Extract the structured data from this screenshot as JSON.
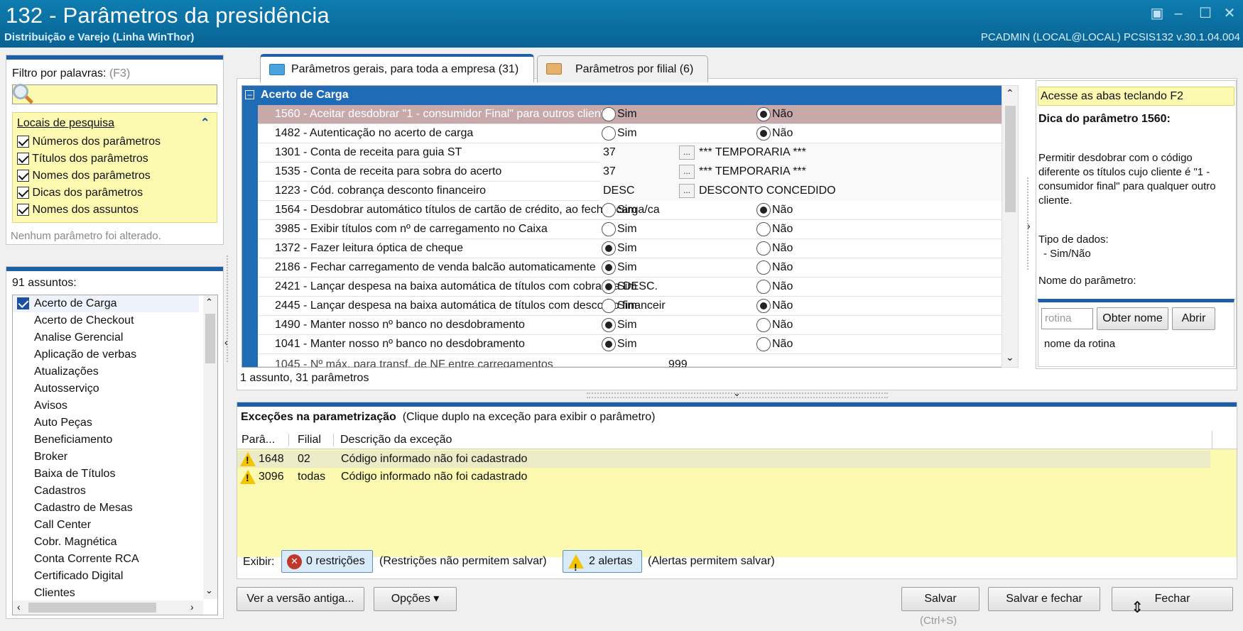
{
  "window": {
    "title": "132 - Parâmetros da presidência",
    "subtitle": "Distribuição e Varejo (Linha WinThor)",
    "user_info": "PCADMIN (LOCAL@LOCAL)   PCSIS132  v.30.1.04.004"
  },
  "filter": {
    "label": "Filtro por palavras:",
    "shortcut": "(F3)",
    "value": "",
    "locations_title": "Locais de pesquisa",
    "locations": [
      {
        "label": "Números dos parâmetros",
        "checked": true
      },
      {
        "label": "Títulos dos parâmetros",
        "checked": true
      },
      {
        "label": "Nomes dos parâmetros",
        "checked": true
      },
      {
        "label": "Dicas dos parâmetros",
        "checked": true
      },
      {
        "label": "Nomes dos assuntos",
        "checked": true
      }
    ],
    "status": "Nenhum parâmetro foi alterado."
  },
  "subjects": {
    "count_label": "91 assuntos:",
    "items": [
      {
        "label": "Acerto de Carga",
        "checked": true
      },
      {
        "label": "Acerto de Checkout"
      },
      {
        "label": "Analise Gerencial"
      },
      {
        "label": "Aplicação de verbas"
      },
      {
        "label": "Atualizações"
      },
      {
        "label": "Autosserviço"
      },
      {
        "label": "Avisos"
      },
      {
        "label": "Auto Peças"
      },
      {
        "label": "Beneficiamento"
      },
      {
        "label": "Broker"
      },
      {
        "label": "Baixa de Títulos"
      },
      {
        "label": "Cadastros"
      },
      {
        "label": "Cadastro de Mesas"
      },
      {
        "label": "Call Center"
      },
      {
        "label": "Cobr. Magnética"
      },
      {
        "label": "Conta Corrente RCA"
      },
      {
        "label": "Certificado Digital"
      },
      {
        "label": "Clientes"
      }
    ]
  },
  "tabs": [
    {
      "label": "Parâmetros gerais, para toda a empresa  (31)",
      "active": true
    },
    {
      "label": "Parâmetros por filial  (6)",
      "active": false
    }
  ],
  "grid": {
    "group_title": "Acerto de Carga",
    "rows": [
      {
        "name": "1560 - Aceitar desdobrar \"1 - consumidor Final\" para outros clientes",
        "type": "radio",
        "value": "Não",
        "selected": true
      },
      {
        "name": "1482 - Autenticação no acerto de carga",
        "type": "radio",
        "value": "Não"
      },
      {
        "name": "1301 - Conta de receita para guia ST",
        "type": "lookup",
        "code": "37",
        "desc": "*** TEMPORARIA ***"
      },
      {
        "name": "1535 - Conta de receita para sobra do acerto",
        "type": "lookup",
        "code": "37",
        "desc": "*** TEMPORARIA ***"
      },
      {
        "name": "1223 - Cód. cobrança desconto financeiro",
        "type": "lookup",
        "code": "DESC",
        "desc": "DESCONTO CONCEDIDO"
      },
      {
        "name": "1564 - Desdobrar automático títulos de cartão de crédito, ao fechar carga/ca",
        "type": "radio",
        "value": "Não"
      },
      {
        "name": "3985 - Exibir títulos com nº de carregamento no Caixa",
        "type": "radio",
        "value": ""
      },
      {
        "name": "1372 - Fazer leitura óptica de cheque",
        "type": "radio",
        "value": "Sim"
      },
      {
        "name": "2186 - Fechar carregamento de venda balcão automaticamente",
        "type": "radio",
        "value": "Sim"
      },
      {
        "name": "2421 - Lançar despesa na baixa automática de títulos com cobrança DESC.",
        "type": "radio",
        "value": "Sim"
      },
      {
        "name": "2445 - Lançar despesa na baixa automática de títulos com desconto financeir",
        "type": "radio",
        "value": "Não"
      },
      {
        "name": "1490 - Manter nosso nº banco no desdobramento",
        "type": "radio",
        "value": "Sim"
      },
      {
        "name": "1041 - Manter nosso nº banco no desdobramento",
        "type": "radio",
        "value": "Sim"
      }
    ],
    "yes_label": "Sim",
    "no_label": "Não",
    "footer": "1 assunto, 31 parâmetros"
  },
  "hint": {
    "banner": "Acesse as abas teclando F2",
    "title": "Dica do parâmetro 1560:",
    "body": "Permitir desdobrar com o código diferente os títulos cujo cliente é \"1 - consumidor final\" para qualquer outro cliente.",
    "data_type_label": "Tipo de dados:",
    "data_type_value": "- Sim/Não",
    "param_name_label": "Nome do parâmetro:",
    "routine_placeholder": "rotina",
    "get_name_button": "Obter nome",
    "open_button": "Abrir",
    "routine_name": "nome da rotina"
  },
  "exceptions": {
    "title": "Exceções na parametrização",
    "subtitle": "(Clique duplo na exceção para exibir o parâmetro)",
    "columns": [
      "Parâ...",
      "Filial",
      "Descrição da exceção"
    ],
    "rows": [
      {
        "param": "1648",
        "filial": "02",
        "desc": "Código informado não foi cadastrado"
      },
      {
        "param": "3096",
        "filial": "todas",
        "desc": "Código informado não foi cadastrado"
      }
    ],
    "show_label": "Exibir:",
    "restrictions_button": "0 restrições",
    "restrictions_note": "(Restrições não permitem salvar)",
    "alerts_button": "2 alertas",
    "alerts_note": "(Alertas permitem salvar)"
  },
  "footer": {
    "old_version_button": "Ver a versão antiga...",
    "options_button": "Opções ▾",
    "save_button": "Salvar",
    "save_shortcut": "(Ctrl+S)",
    "save_close_button": "Salvar e fechar",
    "close_button": "Fechar"
  },
  "colors": {
    "titlebar": "#0a6d9e",
    "accent": "#1f5fa8",
    "highlight_yellow": "#fcf9b0",
    "selected_row": "#c8a9a9"
  }
}
